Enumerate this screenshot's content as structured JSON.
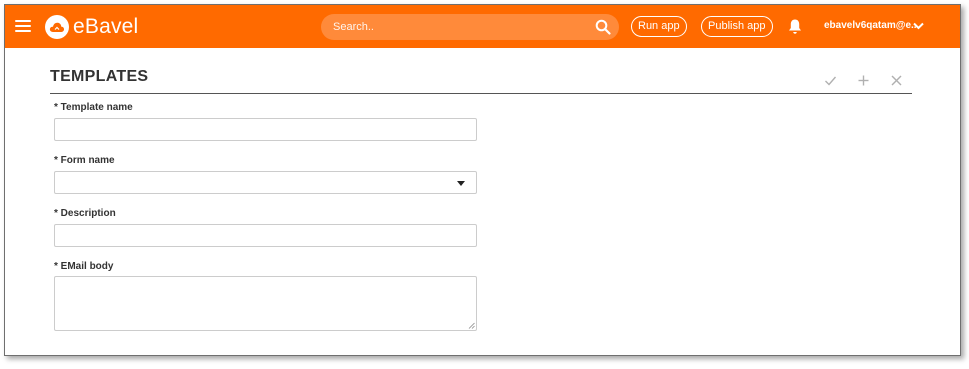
{
  "header": {
    "brand": "eBavel",
    "search_placeholder": "Search..",
    "run_app_label": "Run app",
    "publish_app_label": "Publish app",
    "user_email": "ebavelv6qatam@e...",
    "icons": [
      "menu-icon",
      "cloud-logo-icon",
      "search-icon",
      "bell-icon",
      "chevron-down-icon"
    ]
  },
  "page": {
    "title": "TEMPLATES",
    "toolbar_icons": [
      "check-icon",
      "plus-icon",
      "close-icon"
    ]
  },
  "form": {
    "template_name_label": "* Template name",
    "template_name_value": "",
    "form_name_label": "* Form name",
    "form_name_value": "",
    "description_label": "* Description",
    "description_value": "",
    "email_body_label": "* EMail body",
    "email_body_value": ""
  },
  "colors": {
    "accent": "#ff6a00",
    "search_bg": "#ff8a3a",
    "text": "#333333",
    "input_border": "#cccccc"
  }
}
